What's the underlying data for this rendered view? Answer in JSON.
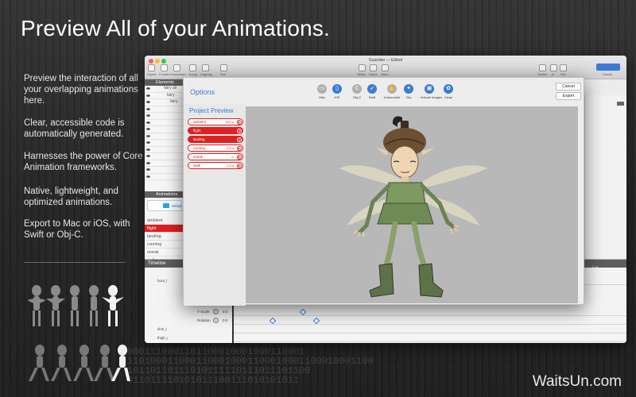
{
  "headline": "Preview All of your Animations.",
  "features": [
    "Preview the interaction of all your overlapping animations here.",
    "Clear, accessible code is automatically generated.",
    "Harnesses the power of Core Animation frameworks.",
    "Native, lightweight, and optimized animations.",
    "Export to Mac or iOS, with Swift or Obj-C."
  ],
  "watermark": "WaitsUn.com",
  "binary_lines": [
    "0001110001101100010001000110001",
    "1101000110001100010001100010001100010001100",
    "10110110111010111110111011101100",
    "011011110101011100111010101011"
  ],
  "window": {
    "title": "Guardian — Edited",
    "toolbar_left": [
      "Export",
      "Forward",
      "Backward",
      "Group",
      "Ungroup",
      "Pan"
    ],
    "toolbar_mid": [
      "Select",
      "Direct",
      "Hand"
    ],
    "toolbar_right": [
      "Center",
      "In",
      "Out"
    ],
    "toolbar_far": "Panels",
    "elements_header": "Elements",
    "element_rows": [
      "fairy all",
      "fairy",
      "fairy"
    ],
    "animations_header": "Animations",
    "setup_label": "setup",
    "animations": [
      "ambient",
      "flight",
      "landing",
      "running",
      "sneak",
      "walk"
    ],
    "selected_animation": "flight",
    "timeline_header": "Timeline",
    "ruler_mark": "3.25",
    "timeline_rows": [
      "boot_r",
      "Y Scale",
      "Rotation",
      "shin_r",
      "thigh_r"
    ],
    "timeline_values": [
      "0.0",
      "0.0"
    ]
  },
  "options": {
    "title": "Options",
    "icons": [
      {
        "label": "Mac",
        "icon": "mac-icon",
        "active": false
      },
      {
        "label": "iOS",
        "icon": "ios-icon",
        "active": true
      },
      {
        "label": "Obj-C",
        "icon": "objc-icon",
        "active": false
      },
      {
        "label": "Swift",
        "icon": "swift-icon",
        "active": true
      },
      {
        "label": "Unbounded",
        "icon": "unbounded-icon",
        "active": false
      },
      {
        "label": "Clip",
        "icon": "clip-icon",
        "active": true
      },
      {
        "label": "Include Images",
        "icon": "include-images-icon",
        "active": true
      },
      {
        "label": "Clean",
        "icon": "clean-icon",
        "active": true
      }
    ],
    "cancel": "Cancel",
    "export": "Export",
    "project_preview_title": "Project Preview",
    "preview_items": [
      {
        "name": "ambient",
        "value": "10.0 s",
        "active": false
      },
      {
        "name": "flight",
        "value": "",
        "active": true
      },
      {
        "name": "landing",
        "value": "",
        "active": true
      },
      {
        "name": "running",
        "value": "2.0 s",
        "active": false
      },
      {
        "name": "sneak",
        "value": "∞",
        "active": false
      },
      {
        "name": "walk",
        "value": "1.0 s",
        "active": false
      }
    ]
  },
  "colors": {
    "accent": "#3a7bd5",
    "selection": "#e02020",
    "preview_bg": "#b8b8b8"
  }
}
